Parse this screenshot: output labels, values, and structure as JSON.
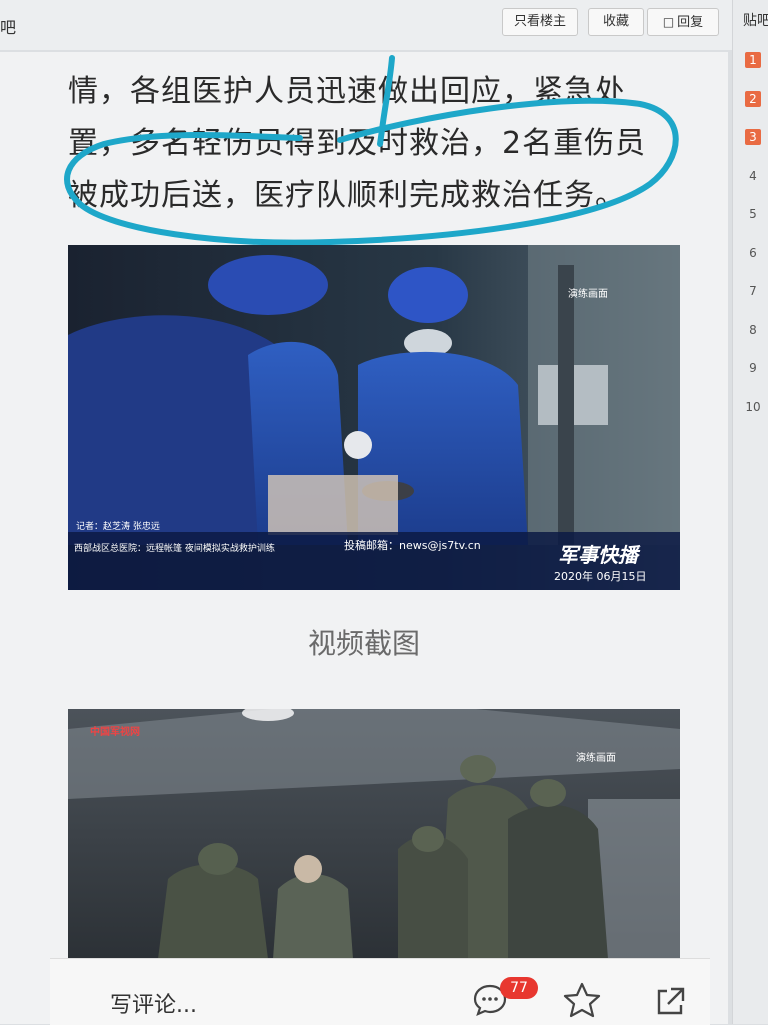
{
  "topbar": {
    "logo_fragment": "吧",
    "only_op_label": "只看楼主",
    "favorite_label": "收藏",
    "reply_label": "回复"
  },
  "rail": {
    "title": "贴吧",
    "items": [
      {
        "num": "1",
        "hot": true
      },
      {
        "num": "2",
        "hot": true
      },
      {
        "num": "3",
        "hot": true
      },
      {
        "num": "4",
        "hot": false
      },
      {
        "num": "5",
        "hot": false
      },
      {
        "num": "6",
        "hot": false
      },
      {
        "num": "7",
        "hot": false
      },
      {
        "num": "8",
        "hot": false
      },
      {
        "num": "9",
        "hot": false
      },
      {
        "num": "10",
        "hot": false
      }
    ]
  },
  "post": {
    "lines": [
      "情，各组医护人员迅速做出回应，紧急处",
      "置，多名轻伤员得到及时救治，2名重伤员",
      "被成功后送，医疗队顺利完成救治任务。"
    ],
    "photo1": {
      "reporter": "记者：赵芝涛 张忠远",
      "ticker": "西部战区总医院：远程帐篷 夜间模拟实战救护训练",
      "email": "投稿邮箱：news@js7tv.cn",
      "program": "军事快播",
      "date": "2020年 06月15日",
      "tag": "演练画面"
    },
    "caption": "视频截图",
    "photo2": {
      "tag": "演练画面",
      "logo": "中国军视网"
    }
  },
  "bottombar": {
    "comment_placeholder": "写评论...",
    "comment_count": "77"
  },
  "colors": {
    "accent_scribble": "#1ea7c9",
    "badge": "#e8372f",
    "hot_rank": "#e96b43"
  },
  "icons": [
    "reply-icon",
    "comment-icon",
    "star-icon",
    "share-icon"
  ]
}
